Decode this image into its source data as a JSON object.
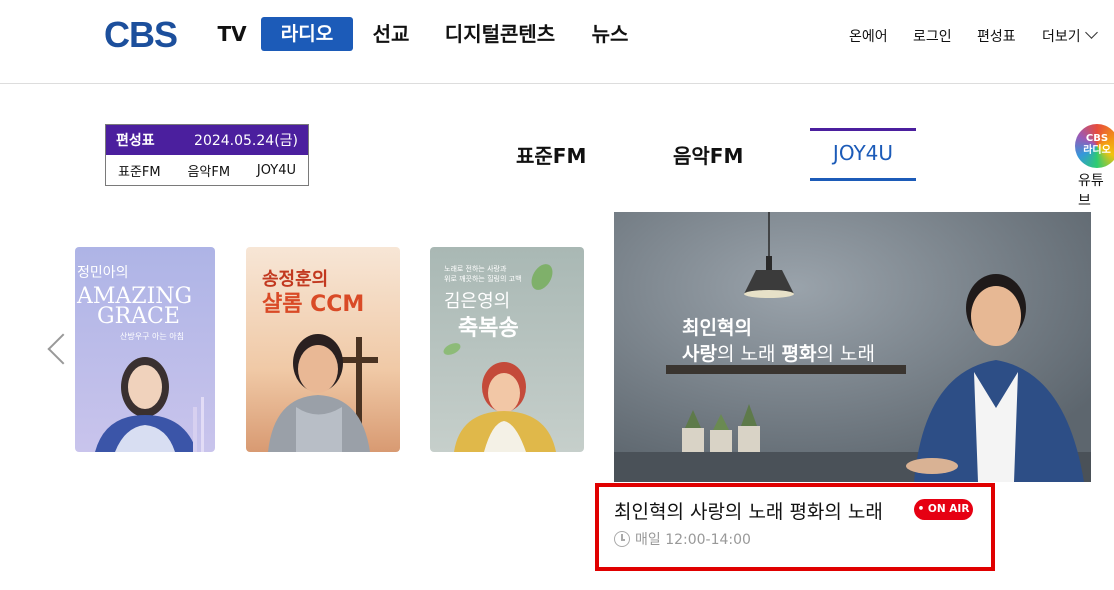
{
  "header": {
    "logo": "CBS",
    "nav": [
      "TV",
      "라디오",
      "선교",
      "디지털콘텐츠",
      "뉴스"
    ],
    "active_nav": "라디오",
    "util": [
      "온에어",
      "로그인",
      "편성표",
      "더보기"
    ]
  },
  "schedule": {
    "title": "편성표",
    "date": "2024.05.24(금)",
    "channels": [
      "표준FM",
      "음악FM",
      "JOY4U"
    ]
  },
  "tabs": [
    "표준FM",
    "음악FM",
    "JOY4U"
  ],
  "active_tab": "JOY4U",
  "youtube": {
    "badge_line1": "CBS",
    "badge_line2": "라디오",
    "label": "유튜브"
  },
  "cards": [
    {
      "line1": "정민아의",
      "line2": "AMAZING",
      "line3": "GRACE",
      "sub": "산방우구 아는 아침"
    },
    {
      "line1": "송정훈의",
      "line2": "샬롬 CCM"
    },
    {
      "top": "노래로 전하는 사랑과",
      "top2": "위로 깨끗하는 힐링의 고백",
      "line1": "김은영의",
      "line2": "축복송"
    }
  ],
  "feature": {
    "art_line1": "최인혁의",
    "art_line2a": "사랑",
    "art_line2b": "의 노래 ",
    "art_line2c": "평화",
    "art_line2d": "의 노래"
  },
  "onair": {
    "title": "최인혁의 사랑의 노래 평화의 노래",
    "badge": "• ON AIR",
    "time": "매일 12:00-14:00"
  },
  "colors": {
    "brand_blue": "#1c5bb8",
    "purple": "#4b1f9e",
    "onair_red": "#e60012",
    "highlight_red": "#e00000"
  }
}
